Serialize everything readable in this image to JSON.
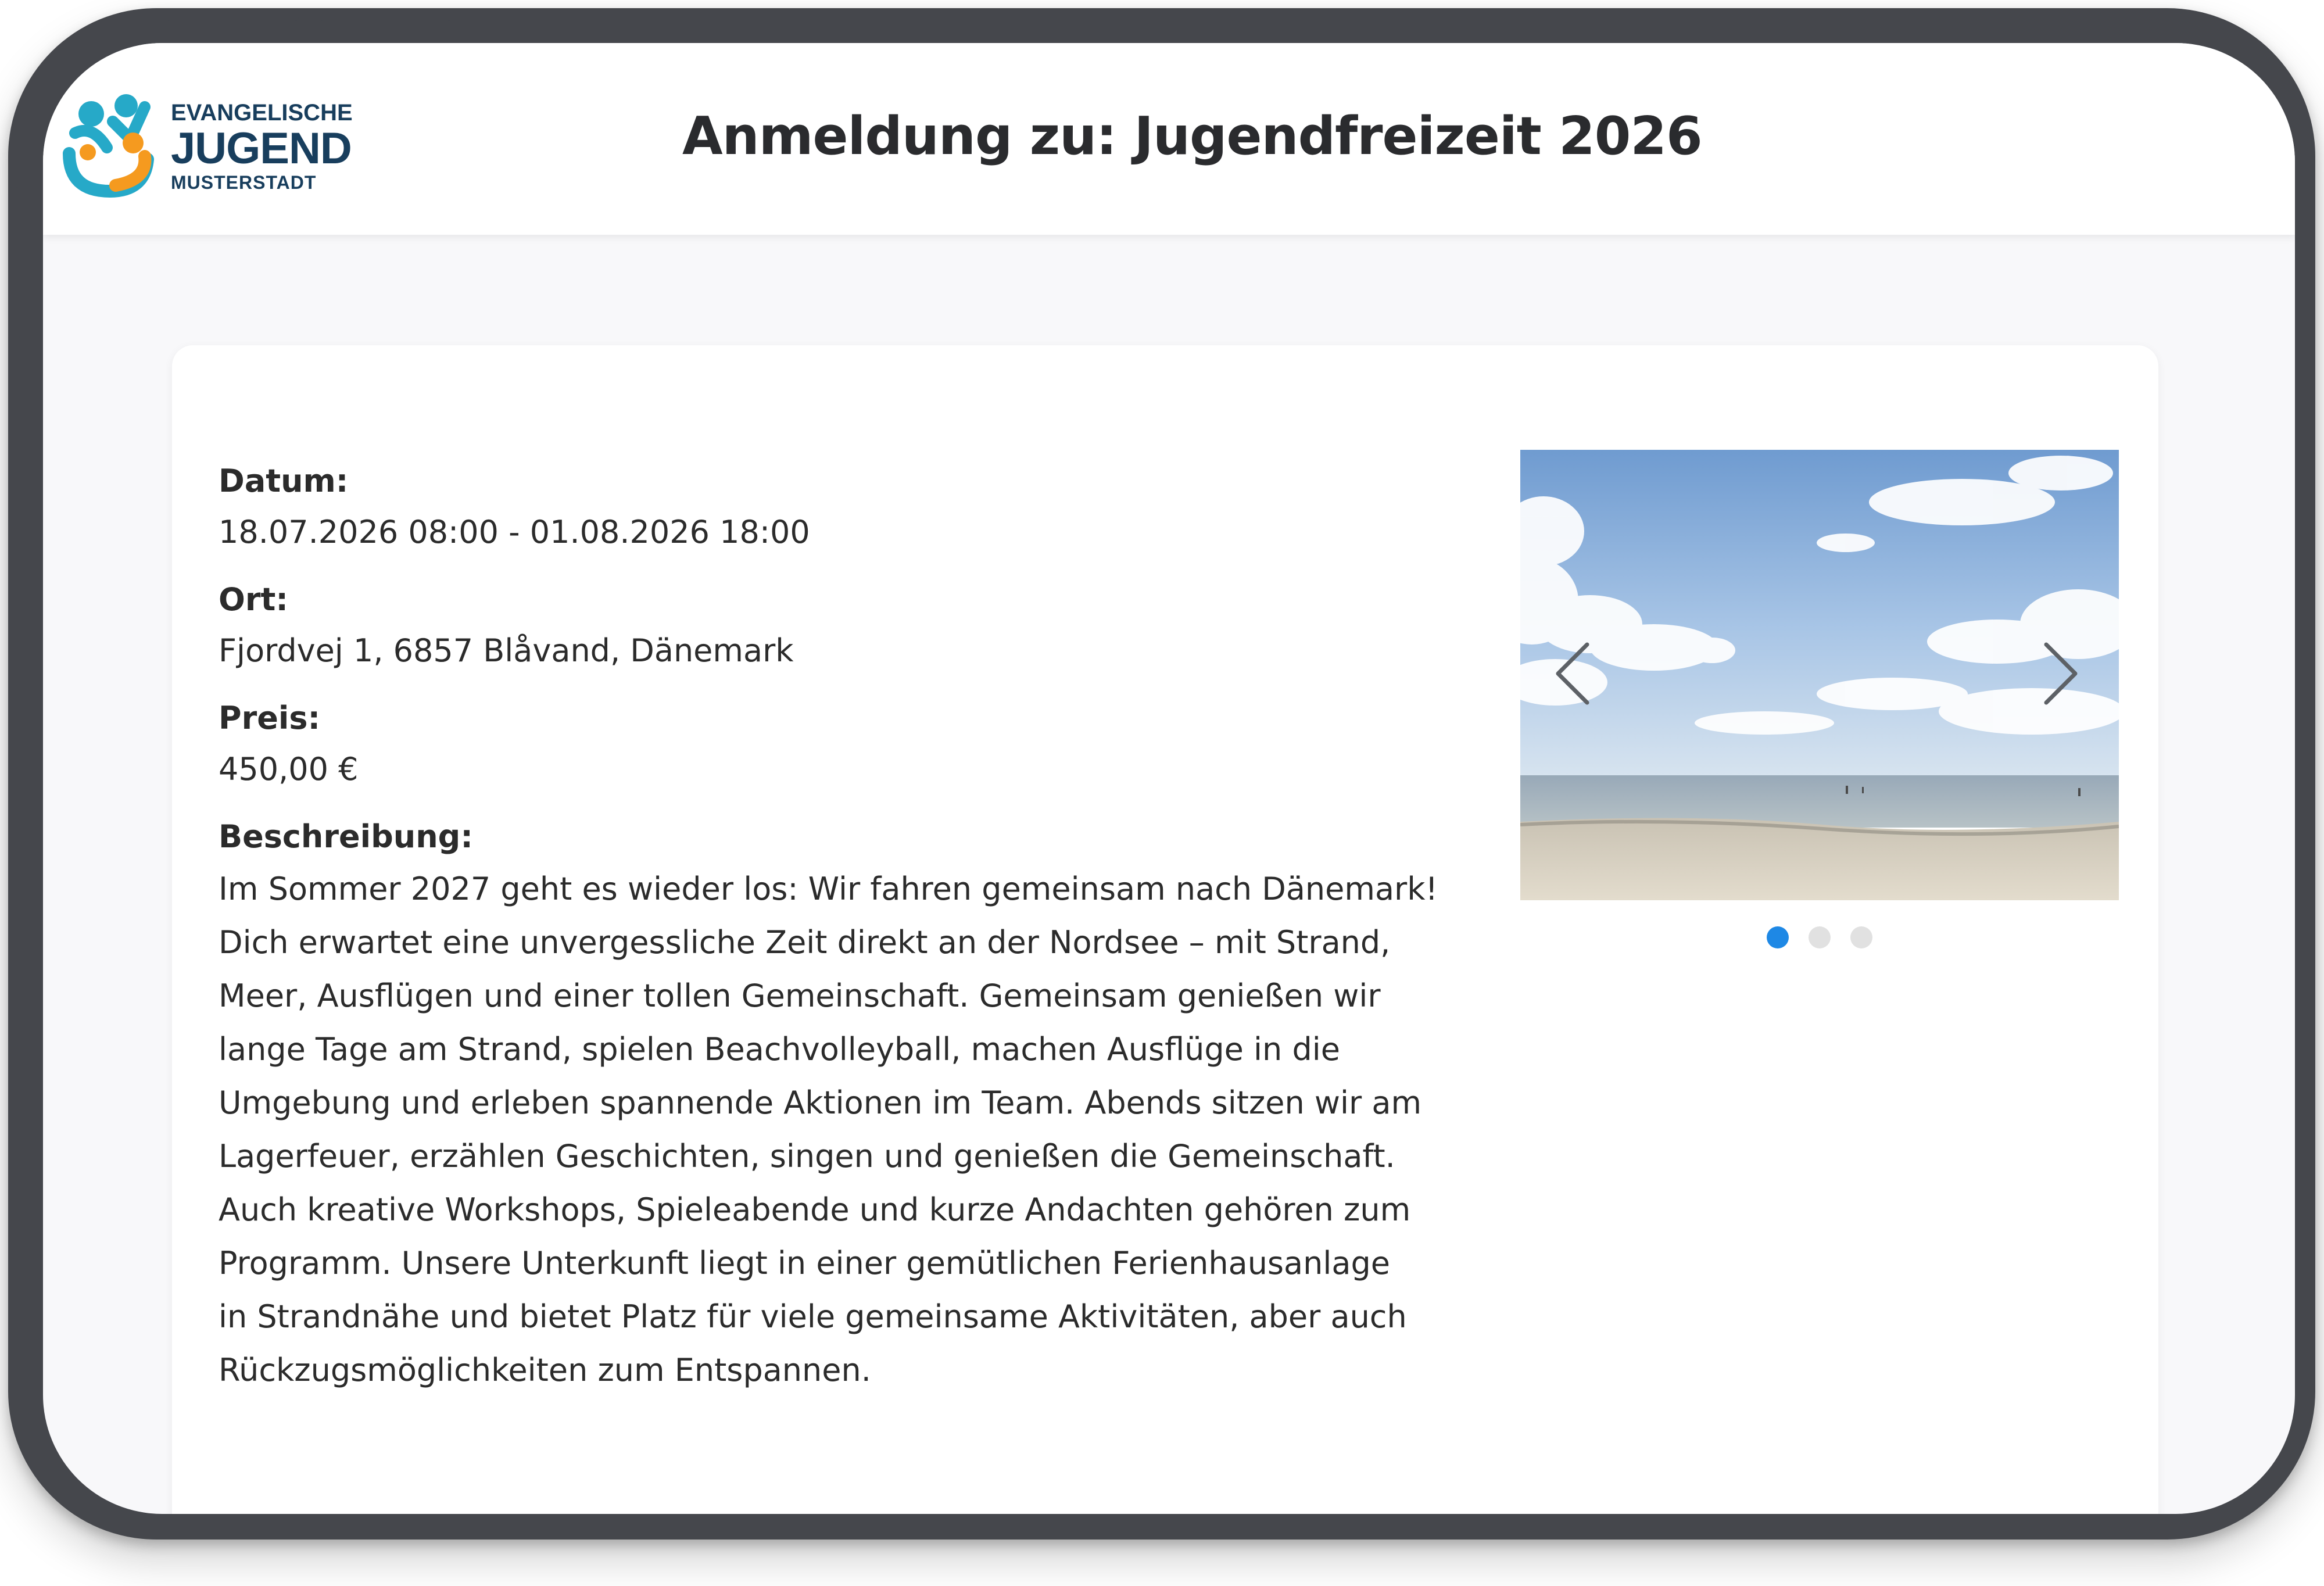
{
  "header": {
    "logo": {
      "line1": "EVANGELISCHE",
      "line2": "JUGEND",
      "line3": "MUSTERSTADT"
    },
    "title": "Anmeldung zu: Jugendfreizeit 2026"
  },
  "event": {
    "date_label": "Datum:",
    "date_value": "18.07.2026 08:00 - 01.08.2026 18:00",
    "location_label": "Ort:",
    "location_value": "Fjordvej 1, 6857 Blåvand, Dänemark",
    "price_label": "Preis:",
    "price_value": "450,00 €",
    "description_label": "Beschreibung:",
    "description": "Im Sommer 2027 geht es wieder los: Wir fahren gemeinsam nach Dänemark!\nDich erwartet eine unvergessliche Zeit direkt an der Nordsee – mit Strand,\nMeer, Ausflügen und einer tollen Gemeinschaft. Gemeinsam genießen wir\nlange Tage am Strand, spielen Beachvolleyball, machen Ausflüge in die\nUmgebung und erleben spannende Aktionen im Team. Abends sitzen wir am\nLagerfeuer, erzählen Geschichten, singen und genießen die Gemeinschaft.\nAuch kreative Workshops, Spieleabende und kurze Andachten gehören zum\nProgramm. Unsere Unterkunft liegt in einer gemütlichen Ferienhausanlage\nin Strandnähe und bietet Platz für viele gemeinsame Aktivitäten, aber auch\nRückzugsmöglichkeiten zum Entspannen."
  },
  "carousel": {
    "slide_count": 3,
    "active_index": 0,
    "image_subject": "beach-photo",
    "prev_icon": "chevron-left-icon",
    "next_icon": "chevron-right-icon"
  },
  "colors": {
    "device_frame": "#45474c",
    "title_text": "#2a2b2e",
    "logo_navy": "#183e5d",
    "logo_teal": "#26a9c8",
    "logo_orange": "#f59a1f",
    "dot_active": "#1e88e5",
    "dot_inactive": "#e1e1e1"
  }
}
